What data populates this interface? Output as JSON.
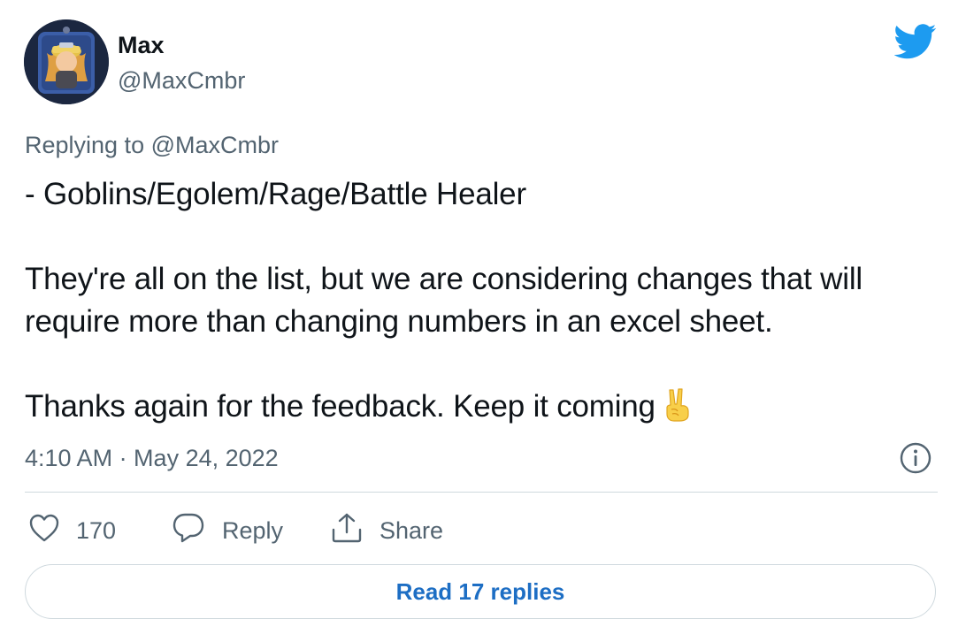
{
  "author": {
    "name": "Max",
    "handle": "@MaxCmbr"
  },
  "reply_context": {
    "prefix": "Replying to ",
    "mention": "@MaxCmbr"
  },
  "tweet": {
    "line1": "- Goblins/Egolem/Rage/Battle Healer",
    "line2": "They're all on the list, but we are considering changes that will require more than changing numbers in an excel sheet.",
    "line3": "Thanks again for the feedback. Keep it coming",
    "emoji": "victory-hand-emoji"
  },
  "timestamp": "4:10 AM · May 24, 2022",
  "actions": {
    "like_count": "170",
    "reply_label": "Reply",
    "share_label": "Share"
  },
  "read_replies_label": "Read 17 replies",
  "icons": {
    "brand": "twitter-bird-icon",
    "info": "info-icon",
    "like": "heart-icon",
    "reply": "speech-bubble-icon",
    "share": "share-upload-icon"
  },
  "colors": {
    "brand_blue": "#1d9bf0",
    "link_blue": "#1d6ec4",
    "muted_text": "#536471",
    "primary_text": "#0f1419",
    "border": "#cfd9de"
  }
}
